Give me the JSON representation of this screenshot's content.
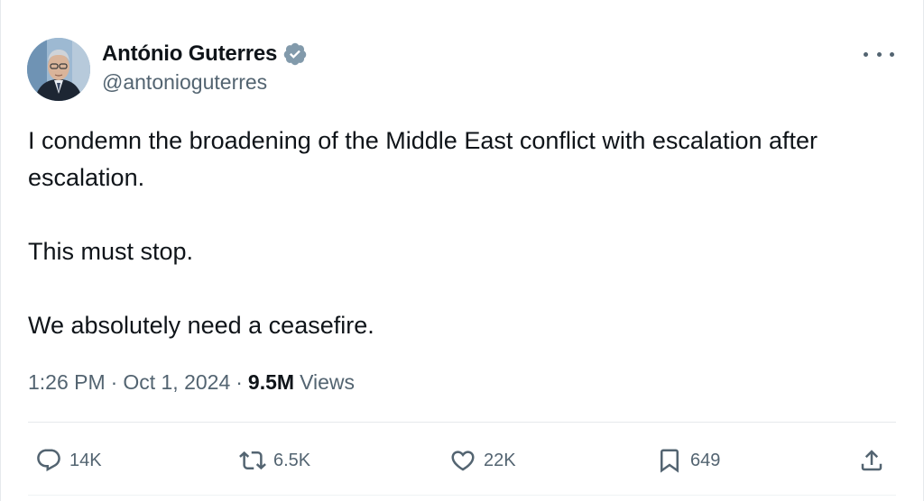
{
  "author": {
    "display_name": "António Guterres",
    "handle": "@antonioguterres",
    "verified_icon": "verified-badge-icon",
    "verified_color": "#829aab"
  },
  "more_icon": "more-options-icon",
  "tweet": {
    "paragraphs": [
      "I condemn the broadening of the Middle East conflict with escalation after escalation.",
      "This must stop.",
      "We absolutely need a ceasefire."
    ]
  },
  "meta": {
    "time": "1:26 PM",
    "separator": "·",
    "date": "Oct 1, 2024",
    "views_count": "9.5M",
    "views_label": "Views"
  },
  "actions": {
    "reply": {
      "icon": "reply-icon",
      "count": "14K"
    },
    "repost": {
      "icon": "repost-icon",
      "count": "6.5K"
    },
    "like": {
      "icon": "heart-icon",
      "count": "22K"
    },
    "bookmark": {
      "icon": "bookmark-icon",
      "count": "649"
    },
    "share": {
      "icon": "share-icon"
    }
  },
  "colors": {
    "text_primary": "#0f1419",
    "text_secondary": "#536471",
    "border": "#e6e9ec"
  }
}
